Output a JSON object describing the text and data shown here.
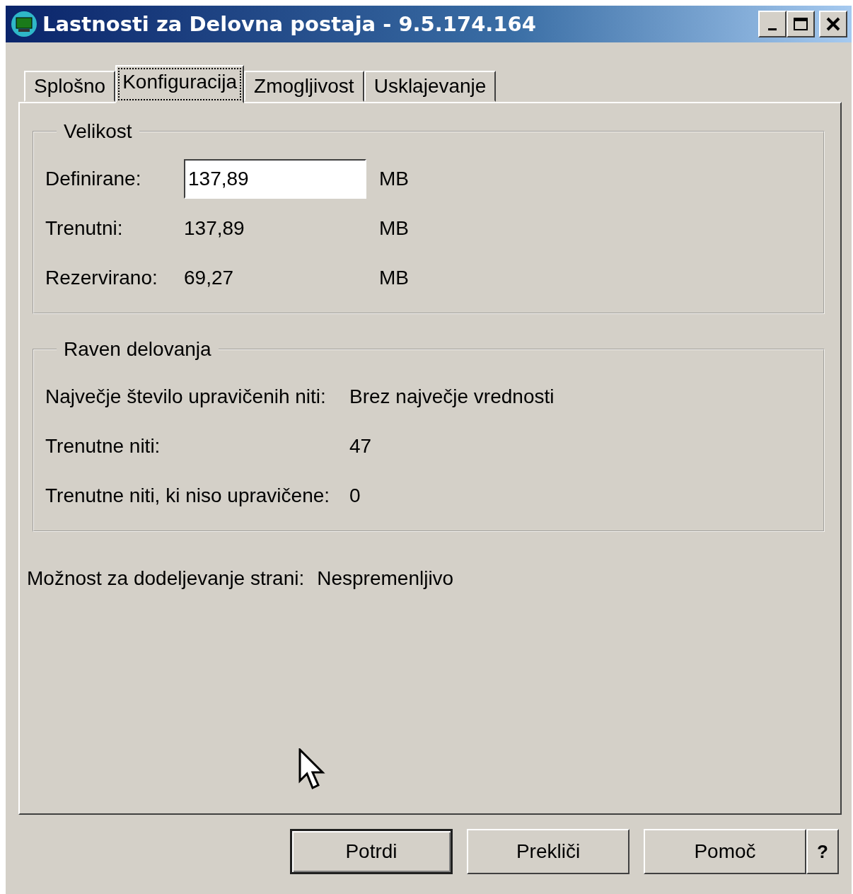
{
  "window": {
    "title": "Lastnosti za Delovna postaja - 9.5.174.164"
  },
  "tabs": [
    {
      "label": "Splošno",
      "selected": false
    },
    {
      "label": "Konfiguracija",
      "selected": true
    },
    {
      "label": "Zmogljivost",
      "selected": false
    },
    {
      "label": "Usklajevanje",
      "selected": false
    }
  ],
  "size_group": {
    "title": "Velikost",
    "rows": [
      {
        "kind": "field",
        "label": "Definirane:",
        "value": "137,89",
        "unit": "MB"
      },
      {
        "kind": "text",
        "label": "Trenutni:",
        "value": "137,89",
        "unit": "MB"
      },
      {
        "kind": "text",
        "label": "Rezervirano:",
        "value": "69,27",
        "unit": "MB"
      }
    ]
  },
  "level_group": {
    "title": "Raven delovanja",
    "rows": [
      {
        "label": "Največje število upravičenih niti:",
        "value": "Brez največje vrednosti"
      },
      {
        "label": "Trenutne niti:",
        "value": "47"
      },
      {
        "label": "Trenutne niti, ki niso upravičene:",
        "value": "0"
      }
    ]
  },
  "paging": {
    "label": "Možnost za dodeljevanje strani:",
    "value": "Nespremenljivo"
  },
  "buttons": [
    {
      "label": "Potrdi",
      "default": true
    },
    {
      "label": "Prekliči",
      "default": false
    },
    {
      "label": "Pomoč",
      "default": false
    }
  ],
  "help_button": "?"
}
